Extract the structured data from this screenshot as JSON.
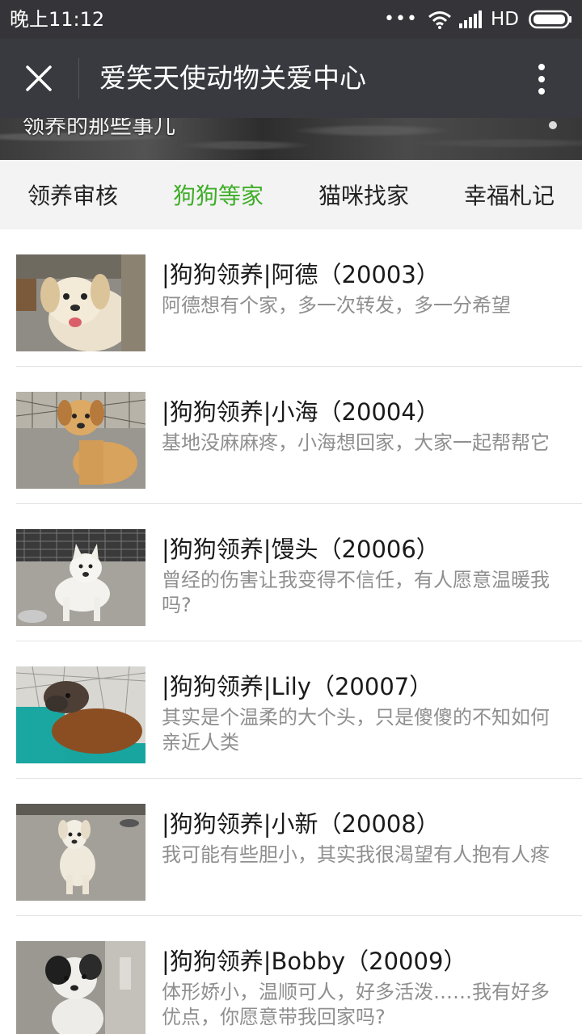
{
  "status_bar": {
    "time": "晚上11:12",
    "dots": "•••",
    "network": "HD"
  },
  "nav": {
    "title": "爱笑天使动物关爱中心",
    "close_icon": "close-icon",
    "more_icon": "more-vertical-icon"
  },
  "banner": {
    "caption": "领养的那些事儿"
  },
  "tabs": [
    {
      "label": "领养审核",
      "active": false
    },
    {
      "label": "狗狗等家",
      "active": true
    },
    {
      "label": "猫咪找家",
      "active": false
    },
    {
      "label": "幸福札记",
      "active": false
    }
  ],
  "colors": {
    "status_bar_bg": "#353539",
    "nav_bar_bg": "#393a3f",
    "accent_green": "#3ead27",
    "desc_gray": "#8f8f8f",
    "tab_bar_bg": "#f3f3f3"
  },
  "articles": [
    {
      "title": "|狗狗领养|阿德（20003）",
      "desc": "阿德想有个家，多一次转发，多一分希望",
      "thumb": "cream-fluffy-dog-photo"
    },
    {
      "title": "|狗狗领养|小海（20004）",
      "desc": "基地没麻麻疼，小海想回家，大家一起帮帮它",
      "thumb": "tan-puppy-photo"
    },
    {
      "title": "|狗狗领养|馒头（20006）",
      "desc": "曾经的伤害让我变得不信任，有人愿意温暖我吗?",
      "thumb": "white-dog-photo"
    },
    {
      "title": "|狗狗领养|Lily（20007）",
      "desc": "其实是个温柔的大个头，只是傻傻的不知如何亲近人类",
      "thumb": "brown-dog-lying-photo"
    },
    {
      "title": "|狗狗领养|小新（20008）",
      "desc": "我可能有些胆小，其实我很渴望有人抱有人疼",
      "thumb": "small-white-dog-photo"
    },
    {
      "title": "|狗狗领养|Bobby（20009）",
      "desc": "体形娇小，温顺可人，好多活泼……我有好多优点，你愿意带我回家吗?",
      "thumb": "black-white-dog-photo"
    }
  ]
}
